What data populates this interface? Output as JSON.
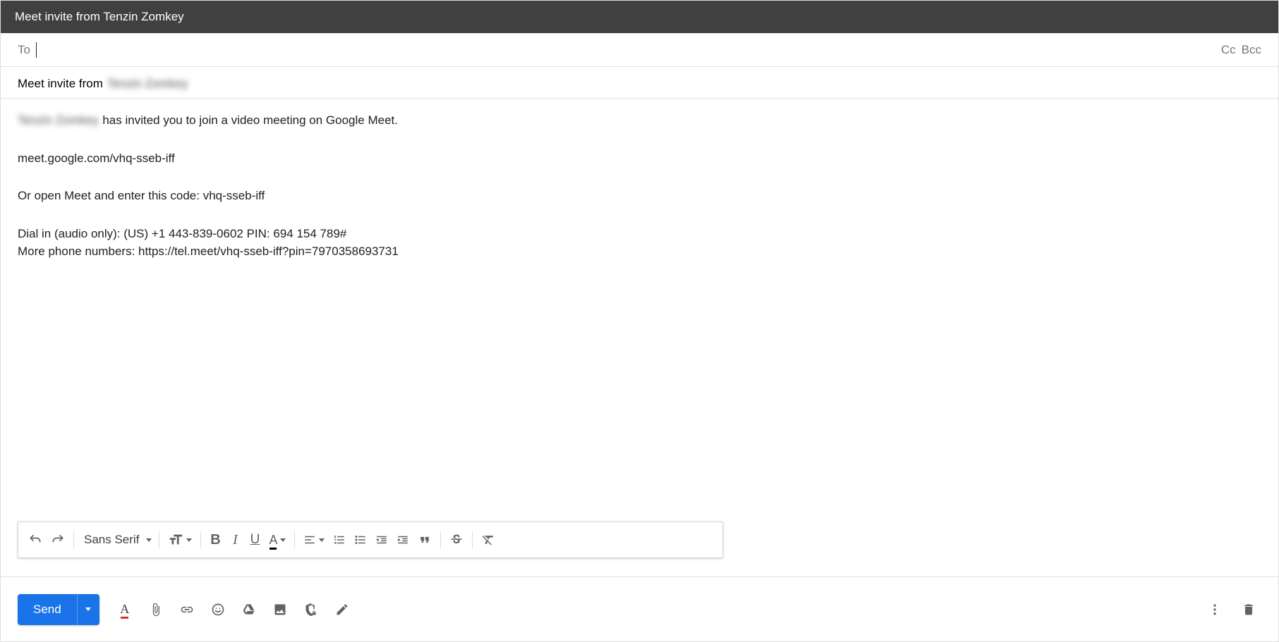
{
  "window": {
    "title": "Meet invite from Tenzin Zomkey"
  },
  "recipients": {
    "to_label": "To",
    "to_value": "",
    "cc_label": "Cc",
    "bcc_label": "Bcc"
  },
  "subject": {
    "prefix": "Meet invite from",
    "redacted_name": "Tenzin Zomkey"
  },
  "body": {
    "invite_line_redacted_name": "Tenzin Zomkey",
    "invite_line_suffix": "has invited you to join a video meeting on Google Meet.",
    "meet_link": "meet.google.com/vhq-sseb-iff",
    "code_line": "Or open Meet and enter this code: vhq-sseb-iff",
    "dial_in_line": "Dial in (audio only): (US) +1 443-839-0602 PIN: 694 154 789#",
    "more_numbers_line": "More phone numbers: https://tel.meet/vhq-sseb-iff?pin=7970358693731"
  },
  "format_toolbar": {
    "font_family": "Sans Serif"
  },
  "actions": {
    "send_label": "Send"
  }
}
